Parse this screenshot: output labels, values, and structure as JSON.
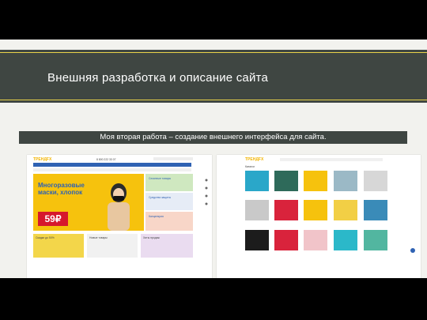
{
  "slide": {
    "title": "Внешняя разработка и описание сайта",
    "subtitle": "Моя вторая работа – создание внешнего интерфейса для сайта."
  },
  "left_shot": {
    "logo_prefix": "ТРЕНД",
    "logo_suffix": "FX",
    "phone": "8 800 222 33 07",
    "hero_title": "Многоразовые\nмаски, хлопок",
    "price": "59₽",
    "promo_cards": [
      "Скидки до 50%",
      "Новые товары",
      "Хиты продаж"
    ],
    "side_cards": [
      "Сезонные товары",
      "Средства защиты",
      "Канцелярия"
    ]
  },
  "right_shot": {
    "logo_prefix": "ТРЕНД",
    "logo_suffix": "FX",
    "section_title": "Каталог"
  },
  "colors": {
    "header_band": "#3f4642",
    "accent_line": "#e9d24a",
    "hero_yellow": "#f6c20d",
    "brand_red": "#d6182c",
    "nav_blue": "#2f62b3"
  }
}
